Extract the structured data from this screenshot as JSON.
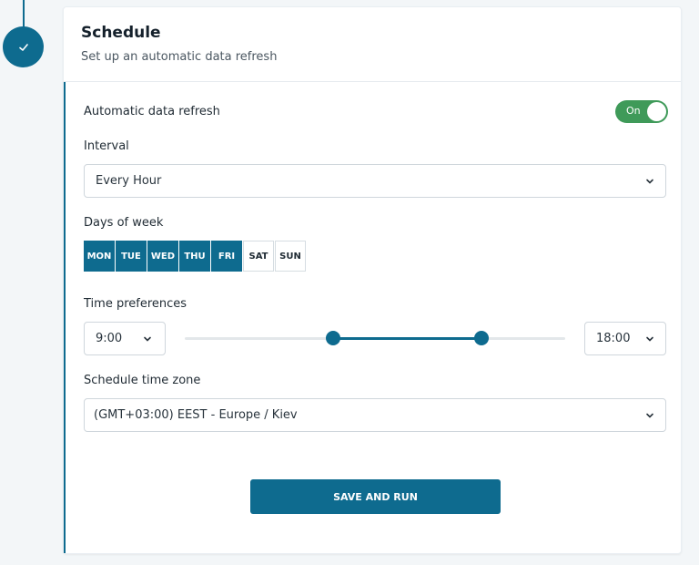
{
  "step": {
    "icon": "check-icon"
  },
  "header": {
    "title": "Schedule",
    "subtitle": "Set up an automatic data refresh"
  },
  "refresh": {
    "label": "Automatic data refresh",
    "toggle_label": "On",
    "enabled": true,
    "toggle_color": "#3f9a59"
  },
  "interval": {
    "label": "Interval",
    "value": "Every Hour"
  },
  "days": {
    "label": "Days of week",
    "items": [
      {
        "label": "MON",
        "selected": true
      },
      {
        "label": "TUE",
        "selected": true
      },
      {
        "label": "WED",
        "selected": true
      },
      {
        "label": "THU",
        "selected": true
      },
      {
        "label": "FRI",
        "selected": true
      },
      {
        "label": "SAT",
        "selected": false
      },
      {
        "label": "SUN",
        "selected": false
      }
    ]
  },
  "time": {
    "label": "Time preferences",
    "start": "9:00",
    "end": "18:00"
  },
  "timezone": {
    "label": "Schedule time zone",
    "value": "(GMT+03:00) EEST - Europe / Kiev"
  },
  "save_label": "SAVE AND RUN",
  "colors": {
    "accent": "#0e6b8f",
    "toggle_on": "#3f9a59"
  }
}
